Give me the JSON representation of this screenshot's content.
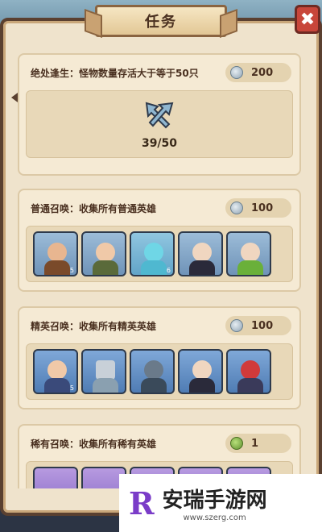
{
  "window": {
    "title": "任务",
    "close_glyph": "✖"
  },
  "quests": [
    {
      "title": "绝处逢生：怪物数量存活大于等于50只",
      "reward": "200",
      "reward_icon": "silver-coin-icon",
      "progress": "39/50",
      "progress_icon": "crossed-arrows-icon"
    },
    {
      "title": "普通召唤：收集所有普通英雄",
      "reward": "100",
      "reward_icon": "silver-coin-icon",
      "heroes": [
        {
          "name": "monkey-warrior",
          "level": "5",
          "bg": "#8aaecf",
          "skin": "#e8b690",
          "outfit": "#7a4a2a"
        },
        {
          "name": "sword-fighter",
          "level": "",
          "bg": "#8aaecf",
          "skin": "#f0c9a8",
          "outfit": "#5a6a3a"
        },
        {
          "name": "blue-slime-spirit",
          "level": "6",
          "bg": "#7fb8d6",
          "skin": "#6fd6e6",
          "outfit": "#4fb8d0"
        },
        {
          "name": "dark-archer",
          "level": "",
          "bg": "#8aaecf",
          "skin": "#f0d6c0",
          "outfit": "#2a2a3a"
        },
        {
          "name": "green-hood-ranger",
          "level": "",
          "bg": "#8aaecf",
          "skin": "#f0d6c0",
          "outfit": "#6ab03a"
        }
      ]
    },
    {
      "title": "精英召唤：收集所有精英英雄",
      "reward": "100",
      "reward_icon": "silver-coin-icon",
      "heroes": [
        {
          "name": "blonde-swordsman",
          "level": "5",
          "bg": "#6e9ccf",
          "skin": "#f0c9a8",
          "outfit": "#3a4a7a"
        },
        {
          "name": "hammer-weapon",
          "level": "",
          "bg": "#6e9ccf",
          "skin": "#c8d0d8",
          "outfit": "#8aa0b0"
        },
        {
          "name": "armored-knight",
          "level": "",
          "bg": "#6e9ccf",
          "skin": "#6a7a8a",
          "outfit": "#3a4a5a"
        },
        {
          "name": "nun-priestess",
          "level": "",
          "bg": "#6e9ccf",
          "skin": "#f0d6c0",
          "outfit": "#2a2a3a"
        },
        {
          "name": "red-oni-samurai",
          "level": "",
          "bg": "#6e9ccf",
          "skin": "#d03a3a",
          "outfit": "#3a3a5a"
        }
      ]
    },
    {
      "title": "稀有召唤：收集所有稀有英雄",
      "reward": "1",
      "reward_icon": "green-gem-icon"
    }
  ],
  "watermark": {
    "title": "安瑞手游网",
    "url": "www.szerg.com",
    "logo_letter": "R"
  }
}
